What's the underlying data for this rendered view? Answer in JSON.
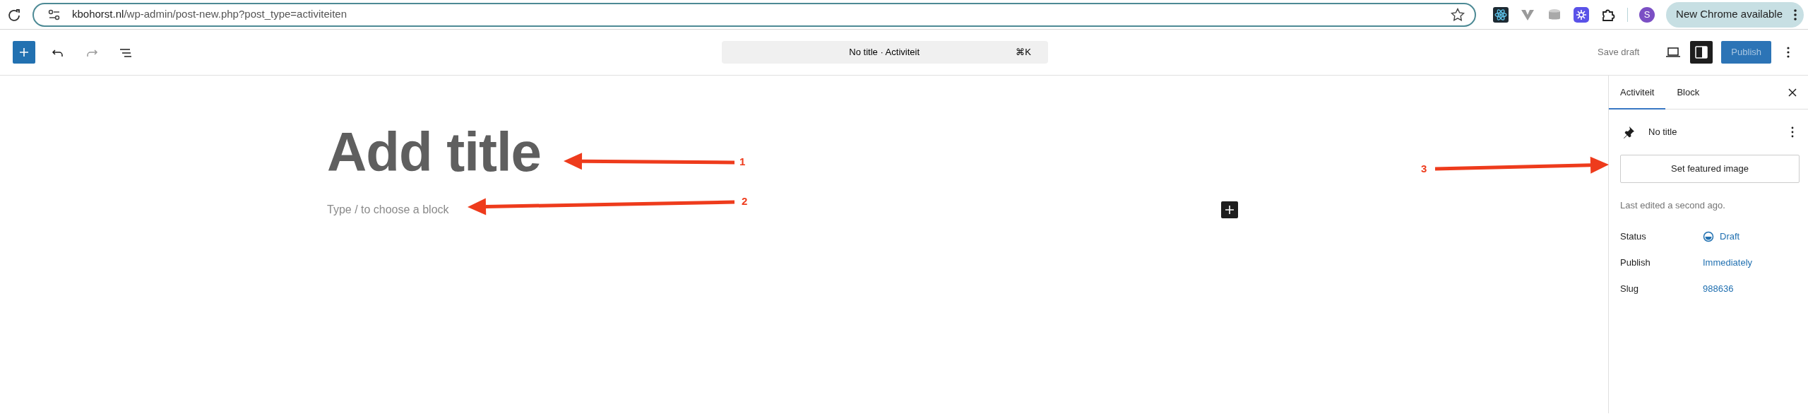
{
  "browser": {
    "url_host": "kbohorst.nl",
    "url_path": "/wp-admin/post-new.php?post_type=activiteiten",
    "profile_initial": "S",
    "update_button": "New Chrome available"
  },
  "editor_header": {
    "command_bar": "No title · Activiteit",
    "shortcut": "⌘K",
    "save_draft": "Save draft",
    "settings_pressed": true,
    "publish": "Publish",
    "publish_disabled": true
  },
  "canvas": {
    "title_placeholder": "Add title",
    "block_placeholder": "Type / to choose a block"
  },
  "annotations": [
    {
      "label": "1"
    },
    {
      "label": "2"
    },
    {
      "label": "3"
    }
  ],
  "sidebar": {
    "tabs": [
      {
        "label": "Activiteit",
        "selected": true
      },
      {
        "label": "Block",
        "selected": false
      }
    ],
    "post_title": "No title",
    "featured_image_button": "Set featured image",
    "last_edited": "Last edited a second ago.",
    "fields": [
      {
        "label": "Status",
        "value": "Draft",
        "kind": "status"
      },
      {
        "label": "Publish",
        "value": "Immediately",
        "kind": "link"
      },
      {
        "label": "Slug",
        "value": "988636",
        "kind": "link"
      }
    ]
  }
}
